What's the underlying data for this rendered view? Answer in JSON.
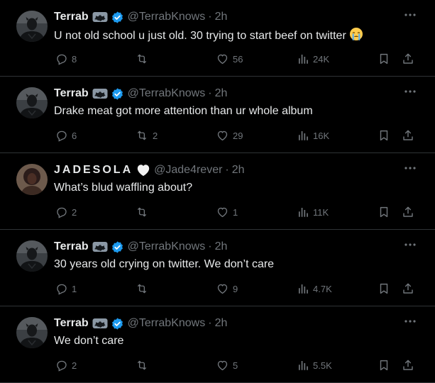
{
  "tweets": [
    {
      "name": "Terrab",
      "handle": "@TerrabKnows",
      "time": "2h",
      "verified": true,
      "emblem": "bat-emblem",
      "avatar": "dark-figure",
      "text": "U not old school u just old. 30 trying to start beef on twitter",
      "emoji": "crying-face-emoji",
      "replies": "8",
      "retweets": "",
      "likes": "56",
      "views": "24K"
    },
    {
      "name": "Terrab",
      "handle": "@TerrabKnows",
      "time": "2h",
      "verified": true,
      "emblem": "bat-emblem",
      "avatar": "dark-figure",
      "text": "Drake meat got more attention than ur whole album",
      "emoji": "",
      "replies": "6",
      "retweets": "2",
      "likes": "29",
      "views": "16K"
    },
    {
      "name": "JADESOLA",
      "handle": "@Jade4rever",
      "time": "2h",
      "verified": false,
      "emblem": "white-heart",
      "avatar": "person-photo",
      "text": "What’s blud waffling about?",
      "emoji": "",
      "replies": "2",
      "retweets": "",
      "likes": "1",
      "views": "11K"
    },
    {
      "name": "Terrab",
      "handle": "@TerrabKnows",
      "time": "2h",
      "verified": true,
      "emblem": "bat-emblem",
      "avatar": "dark-figure",
      "text": "30 years old crying on twitter. We don’t care",
      "emoji": "",
      "replies": "1",
      "retweets": "",
      "likes": "9",
      "views": "4.7K"
    },
    {
      "name": "Terrab",
      "handle": "@TerrabKnows",
      "time": "2h",
      "verified": true,
      "emblem": "bat-emblem",
      "avatar": "dark-figure",
      "text": "We don’t care",
      "emoji": "",
      "replies": "2",
      "retweets": "",
      "likes": "5",
      "views": "5.5K"
    }
  ],
  "colors": {
    "background": "#000000",
    "text": "#e7e9ea",
    "muted": "#71767b",
    "verified": "#1d9bf0",
    "divider": "#2f3336"
  }
}
